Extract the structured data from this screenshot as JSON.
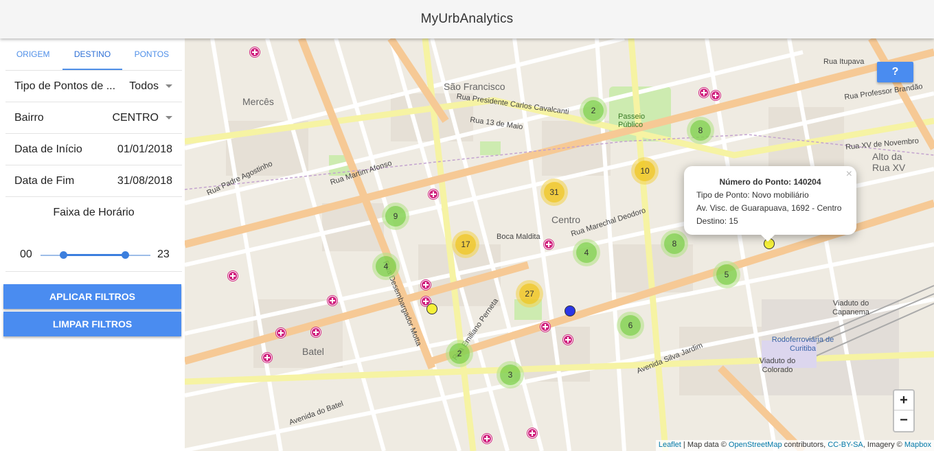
{
  "app": {
    "title": "MyUrbAnalytics"
  },
  "tabs": [
    {
      "label": "ORIGEM",
      "active": false
    },
    {
      "label": "DESTINO",
      "active": true
    },
    {
      "label": "PONTOS",
      "active": false
    }
  ],
  "filters": {
    "tipo": {
      "label": "Tipo de Pontos de ...",
      "value": "Todos"
    },
    "bairro": {
      "label": "Bairro",
      "value": "CENTRO"
    },
    "inicio": {
      "label": "Data de Início",
      "value": "01/01/2018"
    },
    "fim": {
      "label": "Data de Fim",
      "value": "31/08/2018"
    },
    "horario": {
      "label": "Faixa de Horário",
      "min": "00",
      "max": "23",
      "range_low": 0,
      "range_high": 23
    }
  },
  "buttons": {
    "apply": "APLICAR FILTROS",
    "clear": "LIMPAR FILTROS"
  },
  "map": {
    "help": "?",
    "zoom_in": "+",
    "zoom_out": "−",
    "clusters": [
      {
        "count": "2",
        "color": "green"
      },
      {
        "count": "8",
        "color": "green"
      },
      {
        "count": "10",
        "color": "yellow"
      },
      {
        "count": "31",
        "color": "yellow"
      },
      {
        "count": "9",
        "color": "green"
      },
      {
        "count": "17",
        "color": "yellow"
      },
      {
        "count": "4",
        "color": "green"
      },
      {
        "count": "8",
        "color": "green"
      },
      {
        "count": "4",
        "color": "green"
      },
      {
        "count": "5",
        "color": "green"
      },
      {
        "count": "27",
        "color": "yellow"
      },
      {
        "count": "6",
        "color": "green"
      },
      {
        "count": "2",
        "color": "green"
      },
      {
        "count": "3",
        "color": "green"
      }
    ],
    "popup": {
      "title": "Número do Ponto: 140204",
      "tipo": "Tipo de Ponto: Novo mobiliário",
      "endereco": "Av. Visc. de Guarapuava, 1692 - Centro",
      "destino": "Destino: 15",
      "close": "×"
    },
    "labels": {
      "sao_francisco": "São Francisco",
      "merces": "Mercês",
      "centro": "Centro",
      "batel": "Batel",
      "alto_rua_xv": "Alto da Rua XV",
      "boca_maldita": "Boca Maldita",
      "passeio_publico": "Passeio Público",
      "viaduto_capanema": "Viaduto do Capanema",
      "rodoferroviaria": "Rodoferroviária de Curitiba",
      "viaduto_colorado": "Viaduto do Colorado",
      "rua_13_maio": "Rua 13 de Maio",
      "rua_pres_carlos": "Rua Presidente Carlos Cavalcanti",
      "rua_martim": "Rua Martim Afonso",
      "rua_marechal": "Rua Marechal Deodoro",
      "av_silva_jardim": "Avenida Silva Jardim",
      "rua_itupava": "Rua Itupava",
      "rua_xv_novembro": "Rua XV de Novembro",
      "rua_padre_agostinho": "Rua Padre Agostinho",
      "rua_emiliano": "Rua Emiliano Perneta",
      "rua_desembargador": "Rua Desembargador Motta",
      "avenida_do_batel": "Avenida do Batel",
      "rua_prof_brandao": "Rua Professor Brandão"
    },
    "attribution": {
      "leaflet": "Leaflet",
      "text1": " | Map data © ",
      "osm": "OpenStreetMap",
      "text2": " contributors, ",
      "cc": "CC-BY-SA",
      "text3": ", Imagery © ",
      "mapbox": "Mapbox"
    }
  }
}
